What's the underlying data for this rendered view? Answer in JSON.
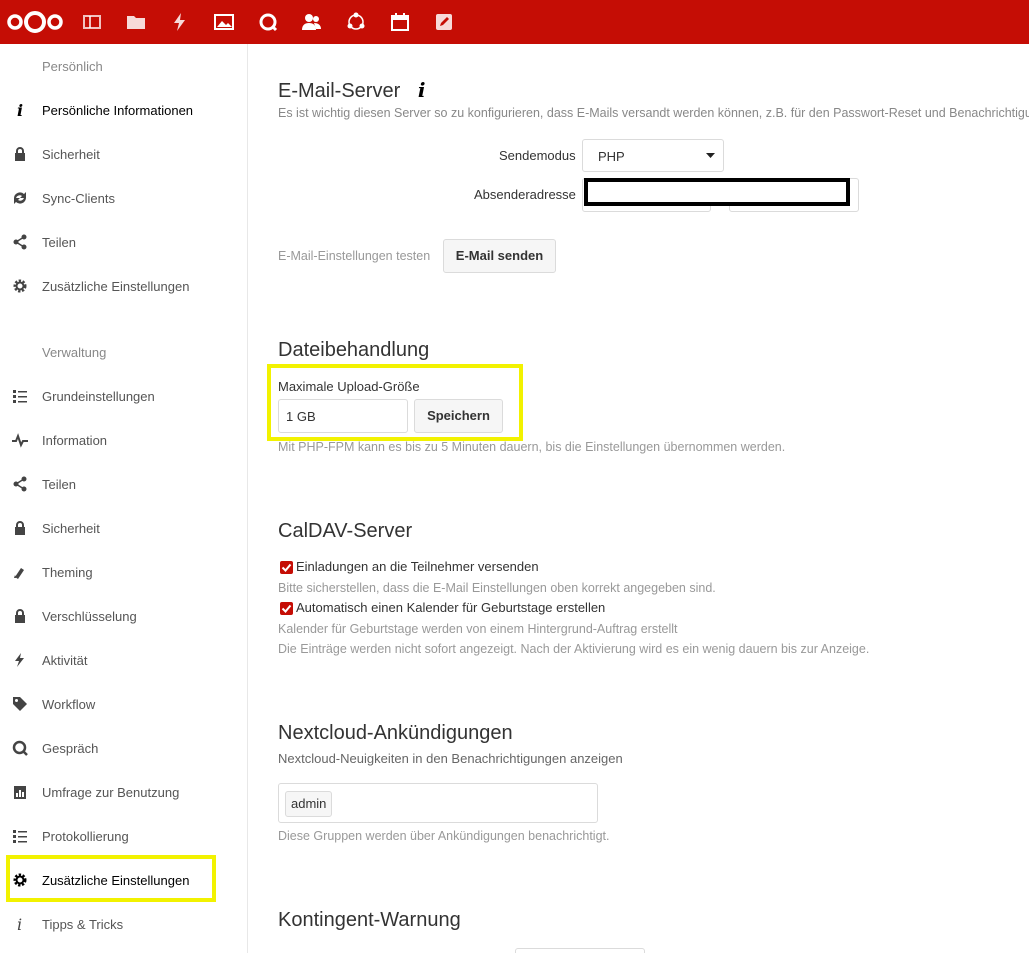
{
  "topbar": {
    "brand_color": "#c50d05",
    "apps": [
      "logo-icon",
      "dashboard-icon",
      "files-icon",
      "activity-icon",
      "gallery-icon",
      "talk-icon",
      "contacts-icon",
      "circles-icon",
      "calendar-icon",
      "notes-icon"
    ]
  },
  "sidebar": {
    "personal_heading": "Persönlich",
    "personal_items": [
      {
        "label": "Persönliche Informationen",
        "icon": "info-icon"
      },
      {
        "label": "Sicherheit",
        "icon": "lock-icon"
      },
      {
        "label": "Sync-Clients",
        "icon": "sync-icon"
      },
      {
        "label": "Teilen",
        "icon": "share-icon"
      },
      {
        "label": "Zusätzliche Einstellungen",
        "icon": "gear-icon"
      }
    ],
    "admin_heading": "Verwaltung",
    "admin_items": [
      {
        "label": "Grundeinstellungen",
        "icon": "list-icon"
      },
      {
        "label": "Information",
        "icon": "pulse-icon"
      },
      {
        "label": "Teilen",
        "icon": "share-icon"
      },
      {
        "label": "Sicherheit",
        "icon": "lock-icon"
      },
      {
        "label": "Theming",
        "icon": "brush-icon"
      },
      {
        "label": "Verschlüsselung",
        "icon": "lock-icon"
      },
      {
        "label": "Aktivität",
        "icon": "bolt-icon"
      },
      {
        "label": "Workflow",
        "icon": "tag-icon"
      },
      {
        "label": "Gespräch",
        "icon": "talk-icon"
      },
      {
        "label": "Umfrage zur Benutzung",
        "icon": "survey-icon"
      },
      {
        "label": "Protokollierung",
        "icon": "list-icon"
      },
      {
        "label": "Zusätzliche Einstellungen",
        "icon": "gear-icon"
      },
      {
        "label": "Tipps & Tricks",
        "icon": "info-icon"
      }
    ]
  },
  "email": {
    "title": "E-Mail-Server",
    "info_glyph": "i",
    "description": "Es ist wichtig diesen Server so zu konfigurieren, dass E-Mails versandt werden können, z.B. für den Passwort-Reset und Benachrichtigungen.",
    "send_mode_label": "Sendemodus",
    "send_mode_value": "PHP",
    "sender_label": "Absenderadresse",
    "test_label": "E-Mail-Einstellungen testen",
    "send_button": "E-Mail senden"
  },
  "files": {
    "title": "Dateibehandlung",
    "upload_label": "Maximale Upload-Größe",
    "upload_value": "1 GB",
    "save_button": "Speichern",
    "note": "Mit PHP-FPM kann es bis zu 5 Minuten dauern, bis die Einstellungen übernommen werden."
  },
  "caldav": {
    "title": "CalDAV-Server",
    "option1": "Einladungen an die Teilnehmer versenden",
    "option1_hint": "Bitte sicherstellen, dass die E-Mail Einstellungen oben korrekt angegeben sind.",
    "option2": "Automatisch einen Kalender für Geburtstage erstellen",
    "option2_hint1": "Kalender für Geburtstage werden von einem Hintergrund-Auftrag erstellt",
    "option2_hint2": "Die Einträge werden nicht sofort angezeigt. Nach der Aktivierung wird es ein wenig dauern bis zur Anzeige."
  },
  "announcements": {
    "title": "Nextcloud-Ankündigungen",
    "description": "Nextcloud-Neuigkeiten in den Benachrichtigungen anzeigen",
    "group_tag": "admin",
    "note": "Diese Gruppen werden über Ankündigungen benachrichtigt."
  },
  "quota": {
    "title": "Kontingent-Warnung"
  }
}
